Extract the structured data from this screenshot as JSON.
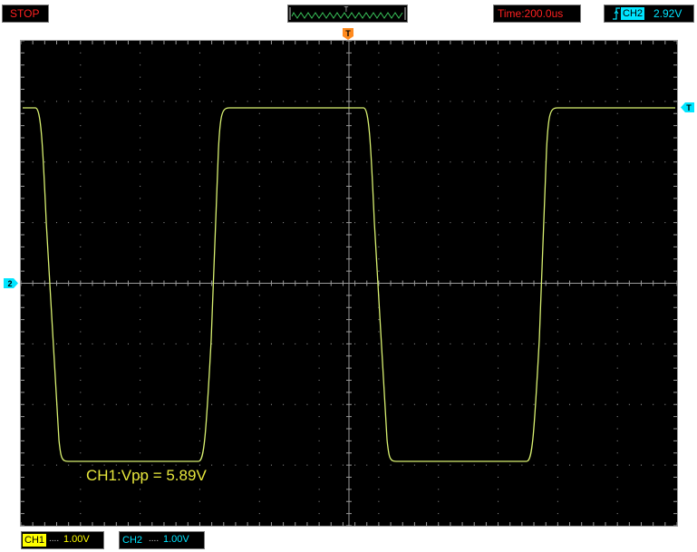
{
  "header": {
    "run_state": "STOP",
    "preview_marker": "T",
    "timebase": "Time:200.0us",
    "trigger": {
      "channel": "CH2",
      "level": "2.92V",
      "slope_icon": "rising-edge-icon"
    }
  },
  "screen": {
    "trigger_position_marker": "T",
    "channel_marker": "2",
    "measurement": "CH1:Vpp = 5.89V"
  },
  "channels": [
    {
      "name": "CH1",
      "coupling": "....",
      "scale": "1.00V",
      "color": "#ffff00",
      "text_color": "#000000"
    },
    {
      "name": "CH2",
      "coupling": "....",
      "scale": "1.00V",
      "color": "#000000",
      "text_color": "#00e5ff"
    }
  ],
  "colors": {
    "trace": "#d8f070",
    "grid": "#9a9a9a",
    "ch2": "#00e5ff",
    "trigger_marker": "#ff8a1e",
    "status_text": "#ff2020"
  }
}
